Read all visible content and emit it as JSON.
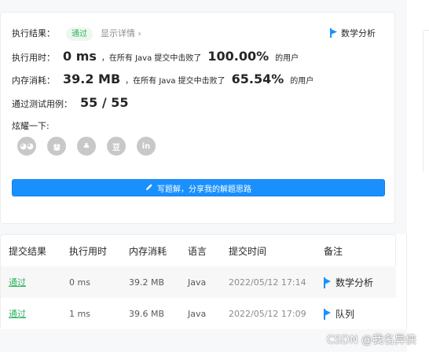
{
  "result": {
    "label": "执行结果：",
    "status": "通过",
    "detail_link": "显示详情 ›",
    "analysis": "数学分析"
  },
  "runtime": {
    "label": "执行用时：",
    "value": "0 ms",
    "middle": "，在所有 Java 提交中击败了",
    "percent": "100.00%",
    "tail": "的用户"
  },
  "memory": {
    "label": "内存消耗：",
    "value": "39.2 MB",
    "middle": "，在所有 Java 提交中击败了",
    "percent": "65.54%",
    "tail": "的用户"
  },
  "tests": {
    "label": "通过测试用例：",
    "value": "55 / 55"
  },
  "share": {
    "label": "炫耀一下:",
    "icons": [
      "wechat-icon",
      "weibo-icon",
      "qq-icon",
      "douban-icon",
      "linkedin-icon"
    ],
    "glyphs": [
      "◕◕",
      "ൠ",
      "♣",
      "豆",
      "in"
    ]
  },
  "write_button": "写题解，分享我的解题思路",
  "table": {
    "headers": [
      "提交结果",
      "执行用时",
      "内存消耗",
      "语言",
      "提交时间",
      "备注"
    ],
    "rows": [
      [
        "通过",
        "0 ms",
        "39.2 MB",
        "Java",
        "2022/05/12 17:14",
        "数学分析"
      ],
      [
        "通过",
        "1 ms",
        "39.6 MB",
        "Java",
        "2022/05/12 17:09",
        "队列"
      ]
    ]
  },
  "watermark": "CSDN @我名异侠",
  "colors": {
    "accent": "#1a90ff",
    "success": "#2db55d",
    "icon_gray": "#c8c8c8"
  }
}
